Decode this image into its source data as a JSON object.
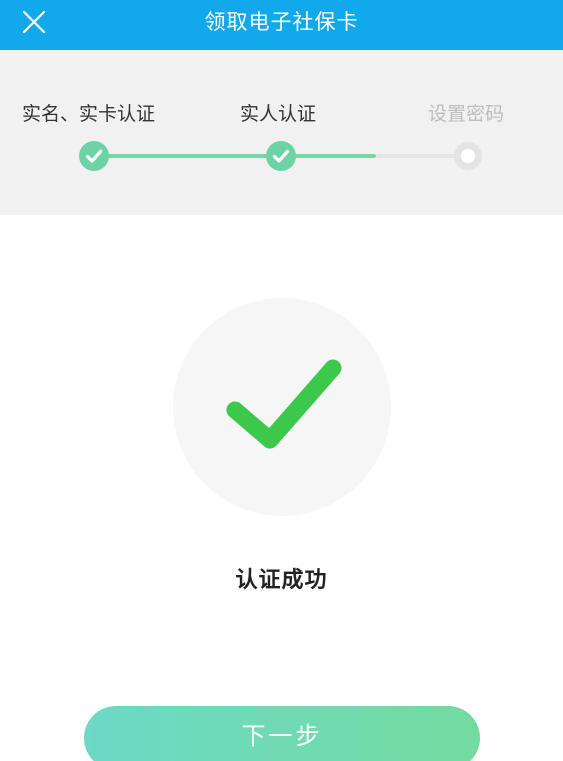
{
  "header": {
    "title": "领取电子社保卡",
    "close_icon": "close-icon"
  },
  "steps": [
    {
      "label": "实名、实卡认证",
      "status": "done"
    },
    {
      "label": "实人认证",
      "status": "done"
    },
    {
      "label": "设置密码",
      "status": "pending"
    }
  ],
  "result": {
    "icon": "check-icon",
    "text": "认证成功"
  },
  "next_button": {
    "label": "下一步"
  },
  "colors": {
    "header_bg": "#12a9ea",
    "step_done": "#6dd3a6",
    "check_green": "#3cc84a",
    "button_start": "#6dd9c6",
    "button_end": "#72dba0"
  }
}
